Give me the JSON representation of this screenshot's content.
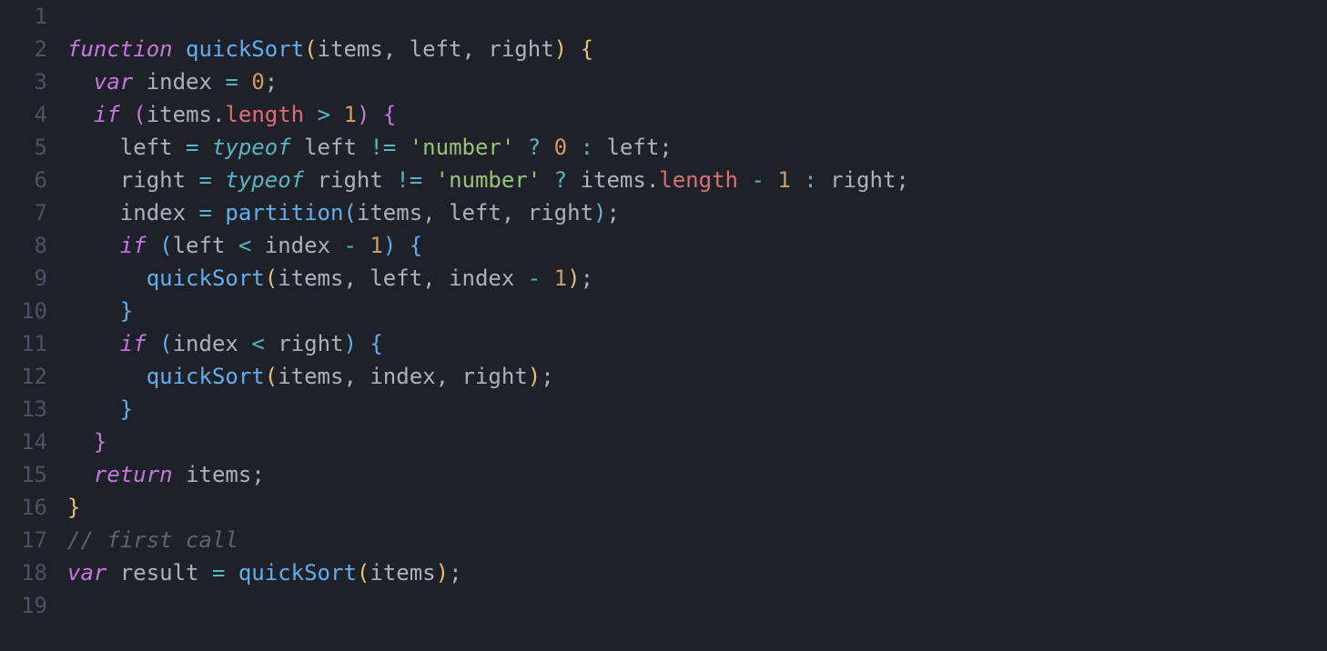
{
  "editor": {
    "language": "javascript",
    "lineNumbers": [
      "1",
      "2",
      "3",
      "4",
      "5",
      "6",
      "7",
      "8",
      "9",
      "10",
      "11",
      "12",
      "13",
      "14",
      "15",
      "16",
      "17",
      "18",
      "19"
    ],
    "lines": [
      [],
      [
        {
          "t": "function ",
          "c": "tok-keyword"
        },
        {
          "t": "quickSort",
          "c": "tok-func-name"
        },
        {
          "t": "(",
          "c": "tok-brace"
        },
        {
          "t": "items",
          "c": "tok-param"
        },
        {
          "t": ", ",
          "c": "tok-punct"
        },
        {
          "t": "left",
          "c": "tok-param"
        },
        {
          "t": ", ",
          "c": "tok-punct"
        },
        {
          "t": "right",
          "c": "tok-param"
        },
        {
          "t": ")",
          "c": "tok-brace"
        },
        {
          "t": " ",
          "c": "tok-punct"
        },
        {
          "t": "{",
          "c": "tok-brace"
        }
      ],
      [
        {
          "t": "  ",
          "c": ""
        },
        {
          "t": "var ",
          "c": "tok-keyword-var"
        },
        {
          "t": "index",
          "c": "tok-ident"
        },
        {
          "t": " ",
          "c": ""
        },
        {
          "t": "=",
          "c": "tok-op"
        },
        {
          "t": " ",
          "c": ""
        },
        {
          "t": "0",
          "c": "tok-number"
        },
        {
          "t": ";",
          "c": "tok-punct"
        }
      ],
      [
        {
          "t": "  ",
          "c": ""
        },
        {
          "t": "if ",
          "c": "tok-keyword"
        },
        {
          "t": "(",
          "c": "tok-brace-alt"
        },
        {
          "t": "items",
          "c": "tok-ident"
        },
        {
          "t": ".",
          "c": "tok-punct"
        },
        {
          "t": "length",
          "c": "tok-prop"
        },
        {
          "t": " ",
          "c": ""
        },
        {
          "t": ">",
          "c": "tok-op"
        },
        {
          "t": " ",
          "c": ""
        },
        {
          "t": "1",
          "c": "tok-number"
        },
        {
          "t": ")",
          "c": "tok-brace-alt"
        },
        {
          "t": " ",
          "c": ""
        },
        {
          "t": "{",
          "c": "tok-brace-alt"
        }
      ],
      [
        {
          "t": "    ",
          "c": ""
        },
        {
          "t": "left",
          "c": "tok-ident"
        },
        {
          "t": " ",
          "c": ""
        },
        {
          "t": "=",
          "c": "tok-op"
        },
        {
          "t": " ",
          "c": ""
        },
        {
          "t": "typeof ",
          "c": "tok-typeof"
        },
        {
          "t": "left",
          "c": "tok-ident"
        },
        {
          "t": " ",
          "c": ""
        },
        {
          "t": "!=",
          "c": "tok-op"
        },
        {
          "t": " ",
          "c": ""
        },
        {
          "t": "'number'",
          "c": "tok-string"
        },
        {
          "t": " ",
          "c": ""
        },
        {
          "t": "?",
          "c": "tok-op"
        },
        {
          "t": " ",
          "c": ""
        },
        {
          "t": "0",
          "c": "tok-number"
        },
        {
          "t": " ",
          "c": ""
        },
        {
          "t": ":",
          "c": "tok-op"
        },
        {
          "t": " ",
          "c": ""
        },
        {
          "t": "left",
          "c": "tok-ident"
        },
        {
          "t": ";",
          "c": "tok-punct"
        }
      ],
      [
        {
          "t": "    ",
          "c": ""
        },
        {
          "t": "right",
          "c": "tok-ident"
        },
        {
          "t": " ",
          "c": ""
        },
        {
          "t": "=",
          "c": "tok-op"
        },
        {
          "t": " ",
          "c": ""
        },
        {
          "t": "typeof ",
          "c": "tok-typeof"
        },
        {
          "t": "right",
          "c": "tok-ident"
        },
        {
          "t": " ",
          "c": ""
        },
        {
          "t": "!=",
          "c": "tok-op"
        },
        {
          "t": " ",
          "c": ""
        },
        {
          "t": "'number'",
          "c": "tok-string"
        },
        {
          "t": " ",
          "c": ""
        },
        {
          "t": "?",
          "c": "tok-op"
        },
        {
          "t": " ",
          "c": ""
        },
        {
          "t": "items",
          "c": "tok-ident"
        },
        {
          "t": ".",
          "c": "tok-punct"
        },
        {
          "t": "length",
          "c": "tok-prop"
        },
        {
          "t": " ",
          "c": ""
        },
        {
          "t": "-",
          "c": "tok-op"
        },
        {
          "t": " ",
          "c": ""
        },
        {
          "t": "1",
          "c": "tok-number"
        },
        {
          "t": " ",
          "c": ""
        },
        {
          "t": ":",
          "c": "tok-op"
        },
        {
          "t": " ",
          "c": ""
        },
        {
          "t": "right",
          "c": "tok-ident"
        },
        {
          "t": ";",
          "c": "tok-punct"
        }
      ],
      [
        {
          "t": "    ",
          "c": ""
        },
        {
          "t": "index",
          "c": "tok-ident"
        },
        {
          "t": " ",
          "c": ""
        },
        {
          "t": "=",
          "c": "tok-op"
        },
        {
          "t": " ",
          "c": ""
        },
        {
          "t": "partition",
          "c": "tok-func-call"
        },
        {
          "t": "(",
          "c": "tok-brace-inner"
        },
        {
          "t": "items",
          "c": "tok-ident"
        },
        {
          "t": ", ",
          "c": "tok-punct"
        },
        {
          "t": "left",
          "c": "tok-ident"
        },
        {
          "t": ", ",
          "c": "tok-punct"
        },
        {
          "t": "right",
          "c": "tok-ident"
        },
        {
          "t": ")",
          "c": "tok-brace-inner"
        },
        {
          "t": ";",
          "c": "tok-punct"
        }
      ],
      [
        {
          "t": "    ",
          "c": ""
        },
        {
          "t": "if ",
          "c": "tok-keyword"
        },
        {
          "t": "(",
          "c": "tok-brace-inner"
        },
        {
          "t": "left",
          "c": "tok-ident"
        },
        {
          "t": " ",
          "c": ""
        },
        {
          "t": "<",
          "c": "tok-op"
        },
        {
          "t": " ",
          "c": ""
        },
        {
          "t": "index",
          "c": "tok-ident"
        },
        {
          "t": " ",
          "c": ""
        },
        {
          "t": "-",
          "c": "tok-op"
        },
        {
          "t": " ",
          "c": ""
        },
        {
          "t": "1",
          "c": "tok-number"
        },
        {
          "t": ")",
          "c": "tok-brace-inner"
        },
        {
          "t": " ",
          "c": ""
        },
        {
          "t": "{",
          "c": "tok-brace-inner"
        }
      ],
      [
        {
          "t": "      ",
          "c": ""
        },
        {
          "t": "quickSort",
          "c": "tok-func-call"
        },
        {
          "t": "(",
          "c": "tok-brace"
        },
        {
          "t": "items",
          "c": "tok-ident"
        },
        {
          "t": ", ",
          "c": "tok-punct"
        },
        {
          "t": "left",
          "c": "tok-ident"
        },
        {
          "t": ", ",
          "c": "tok-punct"
        },
        {
          "t": "index",
          "c": "tok-ident"
        },
        {
          "t": " ",
          "c": ""
        },
        {
          "t": "-",
          "c": "tok-op"
        },
        {
          "t": " ",
          "c": ""
        },
        {
          "t": "1",
          "c": "tok-number"
        },
        {
          "t": ")",
          "c": "tok-brace"
        },
        {
          "t": ";",
          "c": "tok-punct"
        }
      ],
      [
        {
          "t": "    ",
          "c": ""
        },
        {
          "t": "}",
          "c": "tok-brace-inner"
        }
      ],
      [
        {
          "t": "    ",
          "c": ""
        },
        {
          "t": "if ",
          "c": "tok-keyword"
        },
        {
          "t": "(",
          "c": "tok-brace-inner"
        },
        {
          "t": "index",
          "c": "tok-ident"
        },
        {
          "t": " ",
          "c": ""
        },
        {
          "t": "<",
          "c": "tok-op"
        },
        {
          "t": " ",
          "c": ""
        },
        {
          "t": "right",
          "c": "tok-ident"
        },
        {
          "t": ")",
          "c": "tok-brace-inner"
        },
        {
          "t": " ",
          "c": ""
        },
        {
          "t": "{",
          "c": "tok-brace-inner"
        }
      ],
      [
        {
          "t": "      ",
          "c": ""
        },
        {
          "t": "quickSort",
          "c": "tok-func-call"
        },
        {
          "t": "(",
          "c": "tok-brace"
        },
        {
          "t": "items",
          "c": "tok-ident"
        },
        {
          "t": ", ",
          "c": "tok-punct"
        },
        {
          "t": "index",
          "c": "tok-ident"
        },
        {
          "t": ", ",
          "c": "tok-punct"
        },
        {
          "t": "right",
          "c": "tok-ident"
        },
        {
          "t": ")",
          "c": "tok-brace"
        },
        {
          "t": ";",
          "c": "tok-punct"
        }
      ],
      [
        {
          "t": "    ",
          "c": ""
        },
        {
          "t": "}",
          "c": "tok-brace-inner"
        }
      ],
      [
        {
          "t": "  ",
          "c": ""
        },
        {
          "t": "}",
          "c": "tok-brace-alt"
        }
      ],
      [
        {
          "t": "  ",
          "c": ""
        },
        {
          "t": "return ",
          "c": "tok-keyword"
        },
        {
          "t": "items",
          "c": "tok-ident"
        },
        {
          "t": ";",
          "c": "tok-punct"
        }
      ],
      [
        {
          "t": "}",
          "c": "tok-brace"
        }
      ],
      [
        {
          "t": "// first call",
          "c": "tok-comment"
        }
      ],
      [
        {
          "t": "var ",
          "c": "tok-keyword-var"
        },
        {
          "t": "result",
          "c": "tok-ident"
        },
        {
          "t": " ",
          "c": ""
        },
        {
          "t": "=",
          "c": "tok-op"
        },
        {
          "t": " ",
          "c": ""
        },
        {
          "t": "quickSort",
          "c": "tok-func-call"
        },
        {
          "t": "(",
          "c": "tok-brace"
        },
        {
          "t": "items",
          "c": "tok-ident"
        },
        {
          "t": ")",
          "c": "tok-brace"
        },
        {
          "t": ";",
          "c": "tok-punct"
        }
      ],
      []
    ]
  }
}
